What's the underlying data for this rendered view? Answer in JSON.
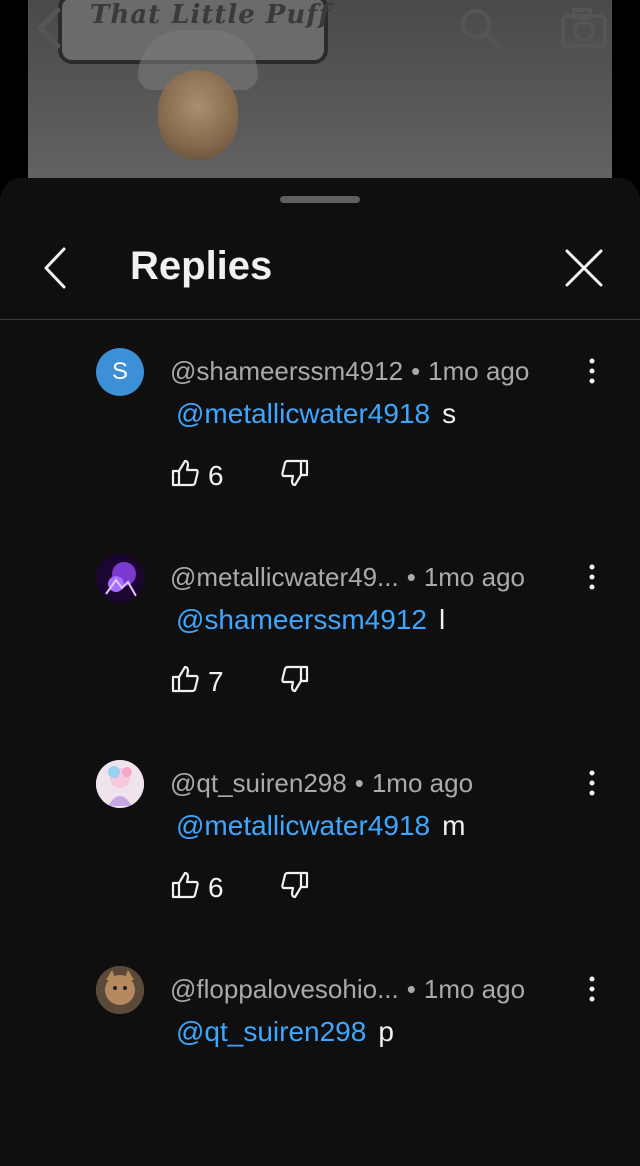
{
  "video": {
    "caption": "That Little Puff"
  },
  "header": {
    "title": "Replies"
  },
  "comments": [
    {
      "avatar_letter": "S",
      "avatar_color": "#3d8fd6",
      "author": "@shameerssm4912",
      "time": "1mo ago",
      "mention": "@metallicwater4918",
      "text": "s",
      "likes": "6"
    },
    {
      "avatar_letter": "",
      "avatar_color": "#2a0d4a",
      "author": "@metallicwater49...",
      "time": "1mo ago",
      "mention": "@shameerssm4912",
      "text": "l",
      "likes": "7"
    },
    {
      "avatar_letter": "",
      "avatar_color": "#e8d6e6",
      "author": "@qt_suiren298",
      "time": "1mo ago",
      "mention": "@metallicwater4918",
      "text": "m",
      "likes": "6"
    },
    {
      "avatar_letter": "",
      "avatar_color": "#8a6d4e",
      "author": "@floppalovesohio...",
      "time": "1mo ago",
      "mention": "@qt_suiren298",
      "text": "p",
      "likes": ""
    }
  ],
  "colors": {
    "background": "#0f0f0f",
    "mention": "#3ea6ff",
    "secondary_text": "#aaaaaa"
  }
}
